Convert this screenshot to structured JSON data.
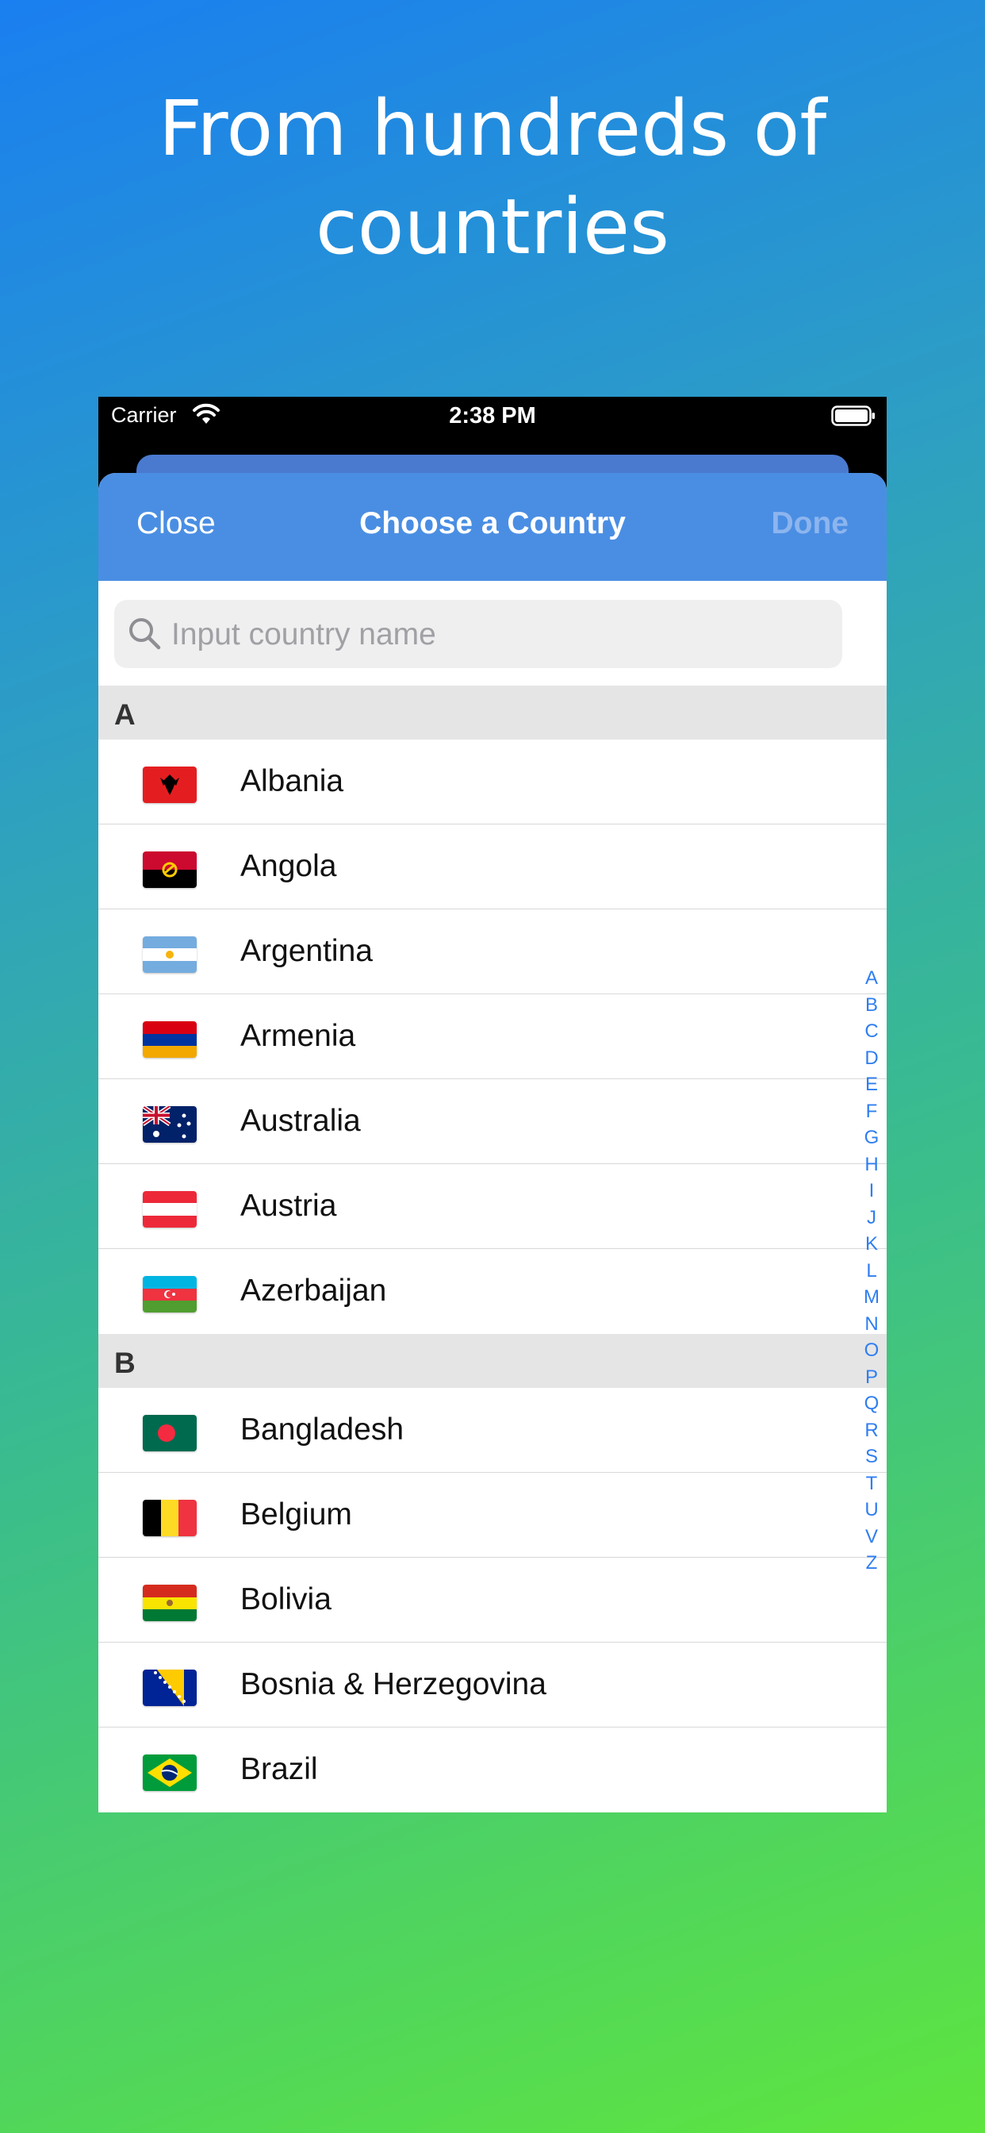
{
  "headline": {
    "line1": "From hundreds of",
    "line2": "countries"
  },
  "status_bar": {
    "carrier": "Carrier",
    "time": "2:38 PM"
  },
  "nav": {
    "close_label": "Close",
    "title": "Choose a Country",
    "done_label": "Done"
  },
  "search": {
    "placeholder": "Input country name",
    "value": ""
  },
  "sections": [
    {
      "letter": "A",
      "countries": [
        "Albania",
        "Angola",
        "Argentina",
        "Armenia",
        "Australia",
        "Austria",
        "Azerbaijan"
      ]
    },
    {
      "letter": "B",
      "countries": [
        "Bangladesh",
        "Belgium",
        "Bolivia",
        "Bosnia & Herzegovina",
        "Brazil"
      ]
    }
  ],
  "index_letters": [
    "A",
    "B",
    "C",
    "D",
    "E",
    "F",
    "G",
    "H",
    "I",
    "J",
    "K",
    "L",
    "M",
    "N",
    "O",
    "P",
    "Q",
    "R",
    "S",
    "T",
    "U",
    "V",
    "Z"
  ],
  "colors": {
    "nav_bar": "#4a8ee3",
    "index_accent": "#2f7ef0",
    "section_header": "#e5e5e6"
  }
}
